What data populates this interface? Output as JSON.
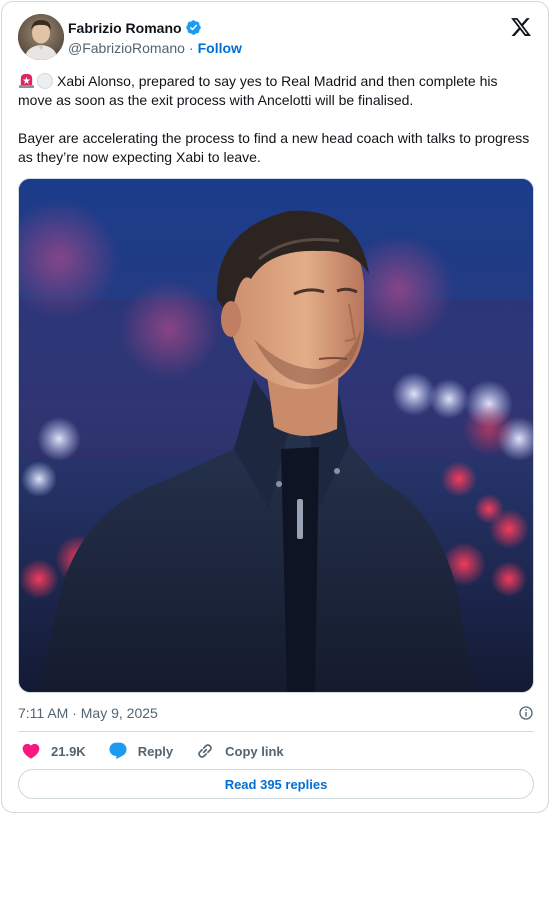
{
  "author": {
    "display_name": "Fabrizio Romano",
    "handle": "@FabrizioRomano",
    "separator": "·",
    "follow_label": "Follow"
  },
  "tweet": {
    "paragraph_1": "Xabi Alonso, prepared to say yes to Real Madrid and then complete his move as soon as the exit process with Ancelotti will be finalised.",
    "paragraph_2": "Bayer are accelerating the process to find a new head coach with talks to progress as they’re now expecting Xabi to leave.",
    "emojis": [
      "police-siren",
      "white-circle"
    ]
  },
  "meta": {
    "timestamp": "7:11 AM · May 9, 2025"
  },
  "actions": {
    "likes": "21.9K",
    "reply_label": "Reply",
    "copy_link_label": "Copy link"
  },
  "read_replies_label": "Read 395 replies",
  "icons": {
    "brand": "x-logo",
    "verified": "verified-badge-icon",
    "info": "info-icon",
    "like": "heart-icon",
    "reply": "speech-bubble-icon",
    "copy": "link-icon"
  },
  "colors": {
    "link_blue": "#006fd6",
    "verified_blue": "#1d9bf0",
    "like_pink": "#f91880",
    "text_primary": "#0f1419",
    "text_secondary": "#536471",
    "border": "#cfd9de"
  }
}
